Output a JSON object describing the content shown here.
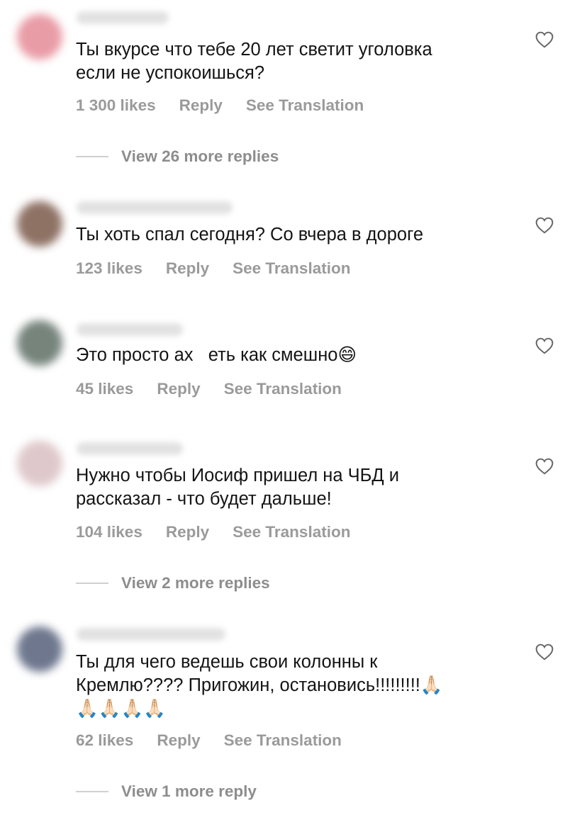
{
  "comments": [
    {
      "text": "Ты вкурсе что тебе 20 лет светит уголовка\nесли не успокоишься?",
      "likes": "1 300 likes",
      "reply": "Reply",
      "translate": "See Translation",
      "view_more": "View 26 more replies",
      "avatar_color": "#e58b97"
    },
    {
      "text": "Ты хоть спал сегодня? Со вчера в дороге",
      "likes": "123 likes",
      "reply": "Reply",
      "translate": "See Translation",
      "avatar_color": "#7b5a4a"
    },
    {
      "text": "Это просто ах   еть как смешно",
      "emoji": "😄",
      "likes": "45 likes",
      "reply": "Reply",
      "translate": "See Translation",
      "avatar_color": "#5f6f66"
    },
    {
      "text": "Нужно чтобы Иосиф пришел на ЧБД и\nрассказал - что будет дальше!",
      "likes": "104 likes",
      "reply": "Reply",
      "translate": "See Translation",
      "view_more": "View 2 more replies",
      "avatar_color": "#d9bfc2"
    },
    {
      "text": "Ты для чего ведешь свои колонны к\nКремлю???? Пригожин, остановись!!!!!!!!!🙏🏻\n🙏🏻🙏🏻🙏🏻🙏🏻",
      "likes": "62 likes",
      "reply": "Reply",
      "translate": "See Translation",
      "view_more": "View 1 more reply",
      "avatar_color": "#55607a"
    }
  ],
  "icons": {
    "like": "heart-outline-icon"
  }
}
